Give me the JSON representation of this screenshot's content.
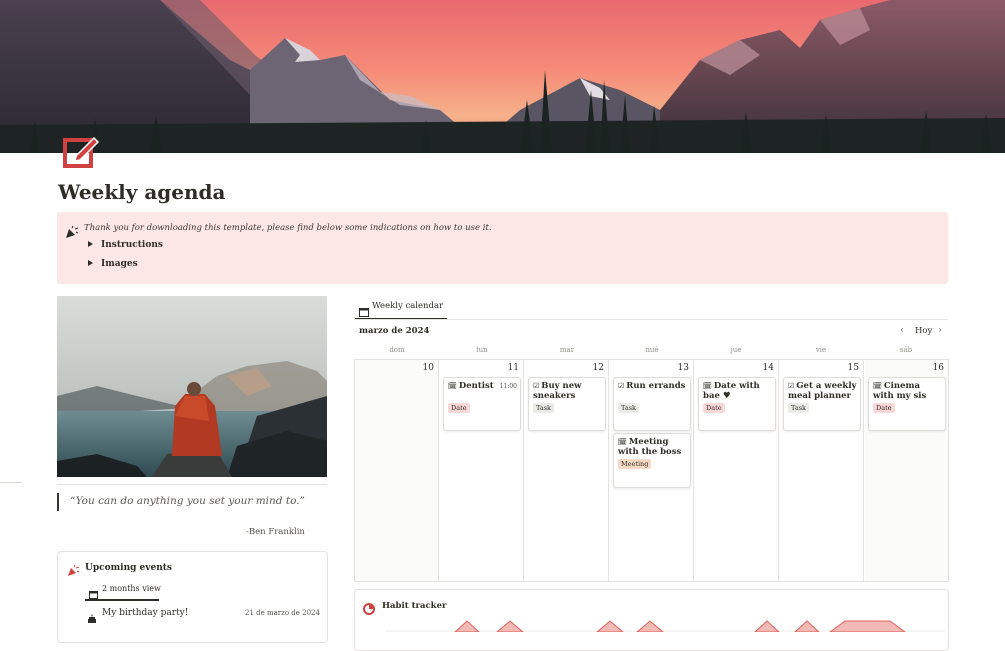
{
  "page": {
    "title": "Weekly agenda",
    "icon": "edit-square-icon"
  },
  "callout": {
    "icon": "party-popper-icon",
    "text": "Thank you for downloading this template, please find below some indications on how to use it.",
    "toggles": [
      "Instructions",
      "Images"
    ]
  },
  "quote": {
    "text": "“You can do anything you set your mind to.”",
    "author": "-Ben Franklin"
  },
  "events": {
    "title": "Upcoming events",
    "tab": "2 months view",
    "rows": [
      {
        "name": "My birthday party!",
        "date": "21 de marzo de 2024"
      }
    ]
  },
  "calendar": {
    "tab": "Weekly calendar",
    "month": "marzo de 2024",
    "today": "Hoy",
    "prev": "‹",
    "next": "›",
    "weekdays": [
      "dom",
      "lun",
      "mar",
      "mié",
      "jue",
      "vie",
      "sáb"
    ],
    "days": [
      "10",
      "11",
      "12",
      "13",
      "14",
      "15",
      "16"
    ],
    "events": [
      {
        "icon": "🗓",
        "title": "Dentist",
        "time": "11:00",
        "tag": "Date"
      },
      {
        "icon": "☑",
        "title": "Buy new sneakers",
        "tag": "Task"
      },
      {
        "icon": "☑",
        "title": "Run errands",
        "tag": "Task"
      },
      {
        "icon": "🗓",
        "title": "Date with bae ♥",
        "tag": "Date"
      },
      {
        "icon": "☑",
        "title": "Get a weekly meal planner",
        "tag": "Task"
      },
      {
        "icon": "🗓",
        "title": "Cinema with my sis",
        "tag": "Date"
      },
      {
        "icon": "🗓",
        "title": "Meeting with the boss",
        "tag": "Meeting"
      }
    ]
  },
  "habit": {
    "title": "Habit tracker",
    "icon": "pie-chart-icon"
  },
  "colors": {
    "accent": "#d0423f",
    "callout_bg": "#fde6e6",
    "tag_date": "#fbd8d8",
    "tag_task": "#ebebe9",
    "tag_meeting": "#f8d9c4"
  }
}
